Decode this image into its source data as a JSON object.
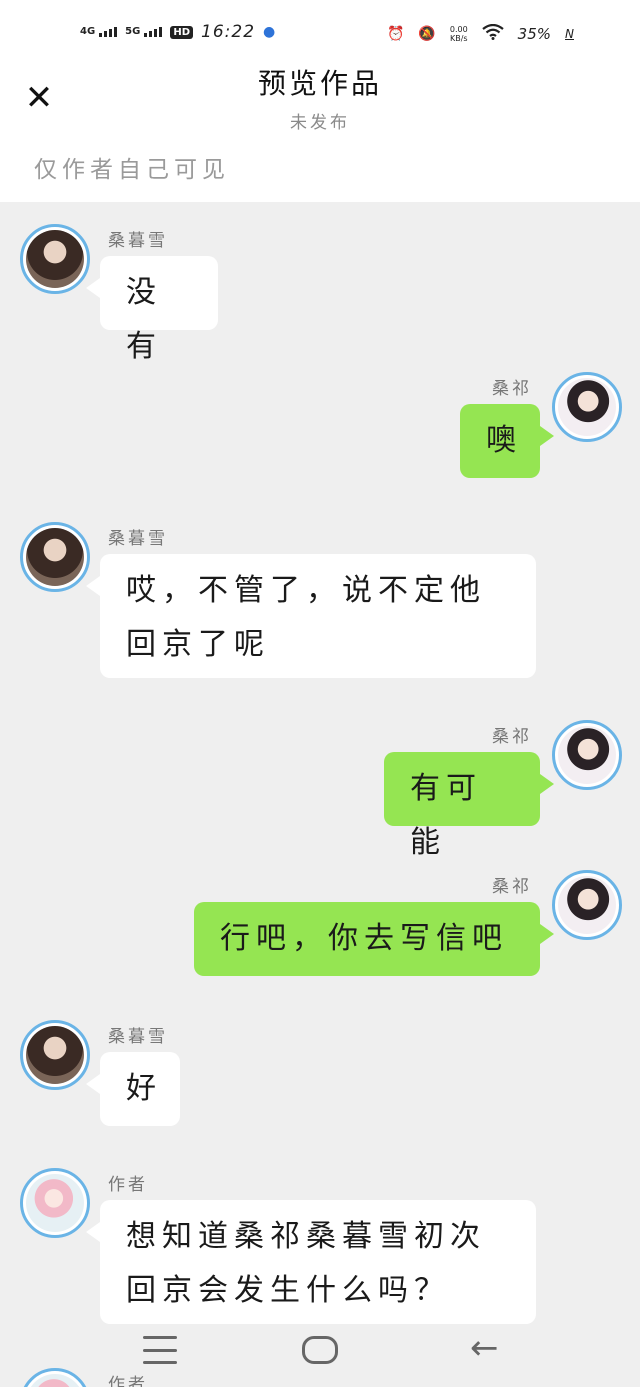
{
  "status_bar": {
    "net1": "4G",
    "net2": "5G",
    "hd": "HD",
    "time": "16:22",
    "speed_value": "0.00",
    "speed_unit": "KB/s",
    "battery": "35%",
    "nfc": "N",
    "icons": [
      "signal-icon",
      "hd-voice-icon",
      "paw-icon",
      "alarm-icon",
      "mute-icon",
      "wifi-icon",
      "nfc-icon"
    ]
  },
  "header": {
    "close_icon": "close-icon",
    "title": "预览作品",
    "subtitle": "未发布",
    "visibility_note": "仅作者自己可见"
  },
  "messages": [
    {
      "sender": "桑暮雪",
      "side": "left",
      "lines": [
        "没有"
      ]
    },
    {
      "sender": "桑祁",
      "side": "right",
      "lines": [
        "噢"
      ]
    },
    {
      "sender": "桑暮雪",
      "side": "left",
      "lines": [
        "哎，不管了，说不定他",
        "回京了呢"
      ]
    },
    {
      "sender": "桑祁",
      "side": "right",
      "lines": [
        "有可能"
      ]
    },
    {
      "sender": "桑祁",
      "side": "right",
      "lines": [
        "行吧，你去写信吧"
      ]
    },
    {
      "sender": "桑暮雪",
      "side": "left",
      "lines": [
        "好"
      ]
    },
    {
      "sender": "作者",
      "side": "left",
      "lines": [
        "想知道桑祁桑暮雪初次",
        "回京会发生什么吗？"
      ]
    },
    {
      "sender": "作者",
      "side": "left",
      "lines": []
    }
  ],
  "colors": {
    "chat_background": "#efefef",
    "left_bubble": "#ffffff",
    "right_bubble": "#95e552",
    "avatar_ring": "#6ab4e6"
  },
  "navbar": {
    "icons": [
      "menu-icon",
      "home-icon",
      "back-icon"
    ],
    "back_glyph": "←"
  }
}
